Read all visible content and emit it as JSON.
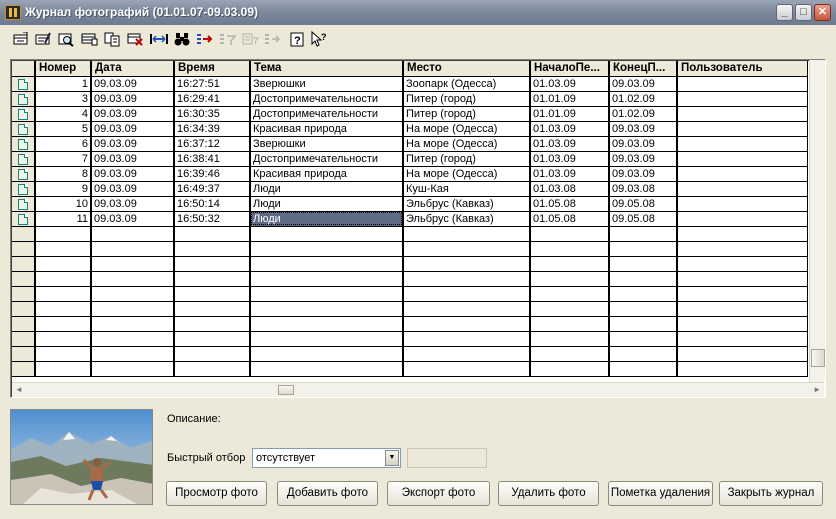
{
  "window": {
    "title": "Журнал фотографий (01.01.07-09.03.09)"
  },
  "titlebar_buttons": {
    "minimize": "_",
    "maximize": "□",
    "close": "✕"
  },
  "toolbar": {
    "items": [
      {
        "name": "add-record",
        "icon": "add-record-icon"
      },
      {
        "name": "edit-record",
        "icon": "edit-record-icon"
      },
      {
        "name": "find",
        "icon": "find-icon"
      },
      {
        "name": "copy-record",
        "icon": "copy-record-icon"
      },
      {
        "name": "copy",
        "icon": "copy-icon"
      },
      {
        "name": "delete-record",
        "icon": "delete-record-icon"
      },
      {
        "name": "interval",
        "icon": "interval-icon"
      },
      {
        "name": "search",
        "icon": "binoculars-icon"
      },
      {
        "name": "filter",
        "icon": "filter-icon"
      },
      {
        "name": "filter-off",
        "icon": "filter-off-icon"
      },
      {
        "name": "help",
        "icon": "help-icon"
      },
      {
        "name": "context-help",
        "icon": "context-help-icon"
      }
    ]
  },
  "grid": {
    "columns": [
      "Номер",
      "Дата",
      "Время",
      "Тема",
      "Место",
      "НачалоПе...",
      "КонецП...",
      "Пользователь"
    ],
    "rows": [
      [
        "1",
        "09.03.09",
        "16:27:51",
        "Зверюшки",
        "Зоопарк (Одесса)",
        "01.03.09",
        "09.03.09",
        ""
      ],
      [
        "3",
        "09.03.09",
        "16:29:41",
        "Достопримечательности",
        "Питер (город)",
        "01.01.09",
        "01.02.09",
        ""
      ],
      [
        "4",
        "09.03.09",
        "16:30:35",
        "Достопримечательности",
        "Питер (город)",
        "01.01.09",
        "01.02.09",
        ""
      ],
      [
        "5",
        "09.03.09",
        "16:34:39",
        "Красивая природа",
        "На море  (Одесса)",
        "01.03.09",
        "09.03.09",
        ""
      ],
      [
        "6",
        "09.03.09",
        "16:37:12",
        "Зверюшки",
        "На море  (Одесса)",
        "01.03.09",
        "09.03.09",
        ""
      ],
      [
        "7",
        "09.03.09",
        "16:38:41",
        "Достопримечательности",
        "Питер (город)",
        "01.03.09",
        "09.03.09",
        ""
      ],
      [
        "8",
        "09.03.09",
        "16:39:46",
        "Красивая природа",
        "На море  (Одесса)",
        "01.03.09",
        "09.03.09",
        ""
      ],
      [
        "9",
        "09.03.09",
        "16:49:37",
        "Люди",
        "Куш-Кая",
        "01.03.08",
        "09.03.08",
        ""
      ],
      [
        "10",
        "09.03.09",
        "16:50:14",
        "Люди",
        "Эльбрус (Кавказ)",
        "01.05.08",
        "09.05.08",
        ""
      ],
      [
        "11",
        "09.03.09",
        "16:50:32",
        "Люди",
        "Эльбрус (Кавказ)",
        "01.05.08",
        "09.05.08",
        ""
      ]
    ],
    "selected_row": 9,
    "selected_col": 3
  },
  "details": {
    "description_label": "Описание:",
    "quick_filter_label": "Быстрый отбор",
    "quick_filter_value": "отсутствует",
    "disabled_button_label": ""
  },
  "actions": [
    {
      "label": "Просмотр фото"
    },
    {
      "label": "Добавить фото"
    },
    {
      "label": "Экспорт фото"
    },
    {
      "label": "Удалить фото"
    },
    {
      "label": "Пометка удаления"
    },
    {
      "label": "Закрыть журнал"
    }
  ],
  "colors": {
    "selection": "#5f6b85",
    "titlebar": "#7b879a",
    "row_icon": "#1f7f7f"
  }
}
